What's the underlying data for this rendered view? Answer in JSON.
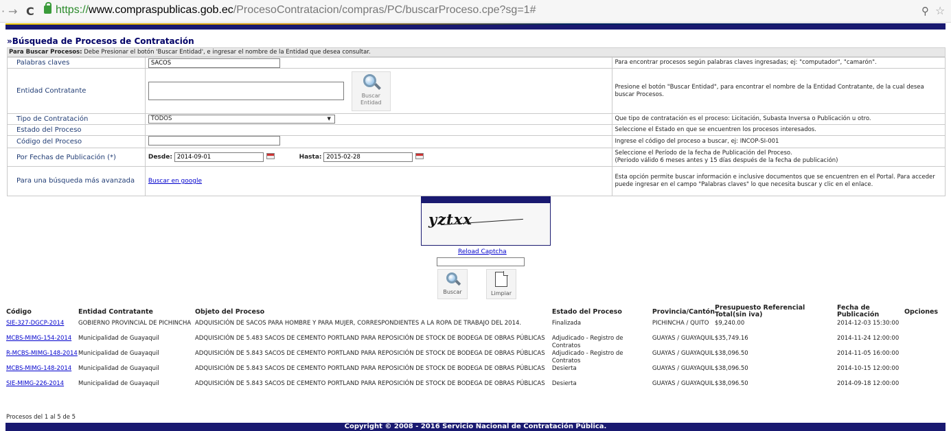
{
  "browser": {
    "url_scheme": "https://",
    "url_host": "www.compraspublicas.gob.ec",
    "url_path": "/ProcesoContratacion/compras/PC/buscarProceso.cpe?sg=1#"
  },
  "page": {
    "title": "»Búsqueda de Procesos de Contratación",
    "instructions_bold": "Para Buscar Procesos:",
    "instructions_text": " Debe Presionar el botón 'Buscar Entidad', e ingresar el nombre de la Entidad que desea consultar."
  },
  "form": {
    "keywords": {
      "label": "Palabras claves",
      "value": "SACOS",
      "help": "Para encontrar procesos según palabras claves ingresadas; ej: \"computador\", \"camarón\"."
    },
    "entity": {
      "label": "Entidad Contratante",
      "button_label_1": "Buscar",
      "button_label_2": "Entidad",
      "help": "Presione el botón \"Buscar Entidad\", para encontrar el nombre de la Entidad Contratante, de la cual desea buscar Procesos."
    },
    "type": {
      "label": "Tipo de Contratación",
      "value": "TODOS",
      "help": "Que tipo de contratación es el proceso: Licitación, Subasta Inversa o Publicación u otro."
    },
    "status": {
      "label": "Estado del Proceso",
      "help": "Seleccione el Estado en que se encuentren los procesos interesados."
    },
    "code": {
      "label": "Código del Proceso",
      "help": "Ingrese el código del proceso a buscar, ej: INCOP-SI-001"
    },
    "dates": {
      "label": "Por Fechas de Publicación (*)",
      "from_label": "Desde:",
      "from_value": "2014-09-01",
      "to_label": "Hasta:",
      "to_value": "2015-02-28",
      "help_1": "Seleccione el Período de la fecha de Publicación del Proceso.",
      "help_2": "(Periodo válido 6 meses antes y 15 días después de la fecha de publicación)"
    },
    "advanced": {
      "label": "Para una búsqueda más avanzada",
      "link": "Buscar en google",
      "help": "Esta opción permite buscar información e inclusive documentos que se encuentren en el Portal. Para acceder puede ingresar en el campo \"Palabras claves\" lo que necesita buscar y clic en el enlace."
    }
  },
  "captcha": {
    "text": "yztxx",
    "reload": "Reload Captcha"
  },
  "buttons": {
    "search": "Buscar",
    "clear": "Limpiar"
  },
  "results": {
    "headers": [
      "Código",
      "Entidad Contratante",
      "Objeto del Proceso",
      "Estado del Proceso",
      "Provincia/Cantón",
      "Presupuesto Referencial Total(sin iva)",
      "Fecha de Publicación",
      "Opciones"
    ],
    "rows": [
      {
        "code": "SIE-327-DGCP-2014",
        "entity": "GOBIERNO PROVINCIAL DE PICHINCHA",
        "object": "ADQUISICIÓN DE SACOS PARA HOMBRE Y PARA MUJER, CORRESPONDIENTES A LA ROPA DE TRABAJO DEL 2014.",
        "status": "Finalizada",
        "location": "PICHINCHA / QUITO",
        "budget": "$9,240.00",
        "date": "2014-12-03 15:30:00"
      },
      {
        "code": "MCBS-MIMG-154-2014",
        "entity": "Municipalidad de Guayaquil",
        "object": "ADQUISICIÓN DE 5.483 SACOS DE CEMENTO PORTLAND PARA REPOSICIÓN DE STOCK DE BODEGA DE OBRAS PÚBLICAS",
        "status": "Adjudicado - Registro de Contratos",
        "location": "GUAYAS / GUAYAQUIL",
        "budget": "$35,749.16",
        "date": "2014-11-24 12:00:00"
      },
      {
        "code": "R-MCBS-MIMG-148-2014",
        "entity": "Municipalidad de Guayaquil",
        "object": "ADQUISICIÓN DE 5.843 SACOS DE CEMENTO PORTLAND PARA REPOSICIÓN DE STOCK DE BODEGA DE OBRAS PÚBLICAS",
        "status": "Adjudicado - Registro de Contratos",
        "location": "GUAYAS / GUAYAQUIL",
        "budget": "$38,096.50",
        "date": "2014-11-05 16:00:00"
      },
      {
        "code": "MCBS-MIMG-148-2014",
        "entity": "Municipalidad de Guayaquil",
        "object": "ADQUISICIÓN DE 5.843 SACOS DE CEMENTO PORTLAND PARA REPOSICIÓN DE STOCK DE BODEGA DE OBRAS PÚBLICAS",
        "status": "Desierta",
        "location": "GUAYAS / GUAYAQUIL",
        "budget": "$38,096.50",
        "date": "2014-10-15 12:00:00"
      },
      {
        "code": "SIE-MIMG-226-2014",
        "entity": "Municipalidad de Guayaquil",
        "object": "ADQUISICIÓN DE 5.843 SACOS DE CEMENTO PORTLAND PARA REPOSICIÓN DE STOCK DE BODEGA DE OBRAS PÚBLICAS",
        "status": "Desierta",
        "location": "GUAYAS / GUAYAQUIL",
        "budget": "$38,096.50",
        "date": "2014-09-18 12:00:00"
      }
    ],
    "pager": "Procesos del 1 al 5 de 5"
  },
  "footer": "Copyright © 2008 - 2016 Servicio Nacional de Contratación Pública."
}
